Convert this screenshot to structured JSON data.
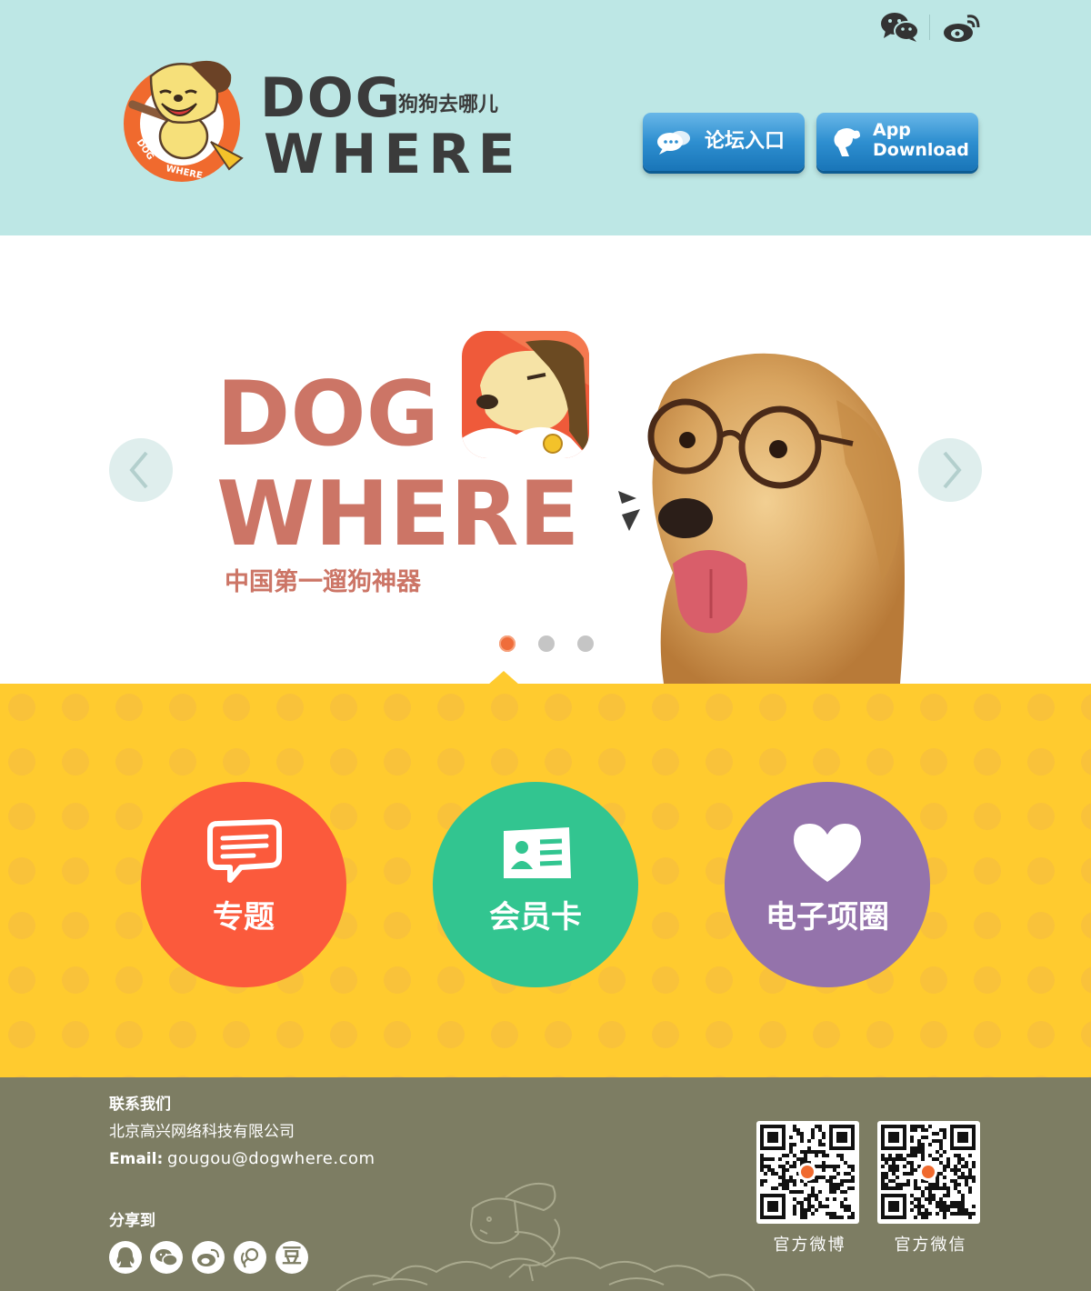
{
  "header": {
    "brand_dog": "DOG",
    "brand_cn": "狗狗去哪儿",
    "brand_where": "WHERE",
    "logo_ring_text": "DOG WHERE",
    "social_icons": [
      "wechat-icon",
      "weibo-icon"
    ],
    "forum_button_label": "论坛入口",
    "app_button_line1": "App",
    "app_button_line2": "Download",
    "background_color": "#bde7e5",
    "button_color": "#2e8fd0"
  },
  "banner": {
    "title_line1": "DOG",
    "title_line2": "WHERE",
    "tagline": "中国第一遛狗神器",
    "title_color": "#cc7566",
    "prev_icon": "chevron-left-icon",
    "next_icon": "chevron-right-icon",
    "slide_count": 3,
    "active_slide": 1
  },
  "features": {
    "background_color": "#ffcb2f",
    "items": [
      {
        "label": "专题",
        "icon": "speech-bubble-icon",
        "color": "#fb5a3c"
      },
      {
        "label": "会员卡",
        "icon": "id-card-icon",
        "color": "#32c590"
      },
      {
        "label": "电子项圈",
        "icon": "heart-icon",
        "color": "#9473ab"
      }
    ]
  },
  "footer": {
    "background_color": "#7d7d63",
    "contact_title": "联系我们",
    "company": "北京高兴网络科技有限公司",
    "email_label": "Email:",
    "email_value": "gougou@dogwhere.com",
    "share_title": "分享到",
    "share_icons": [
      "qq-icon",
      "wechat-icon",
      "weibo-icon",
      "qq-weibo-icon",
      "douban-icon"
    ],
    "douban_glyph": "豆",
    "qr_codes": [
      {
        "label": "官方微博"
      },
      {
        "label": "官方微信"
      }
    ]
  }
}
